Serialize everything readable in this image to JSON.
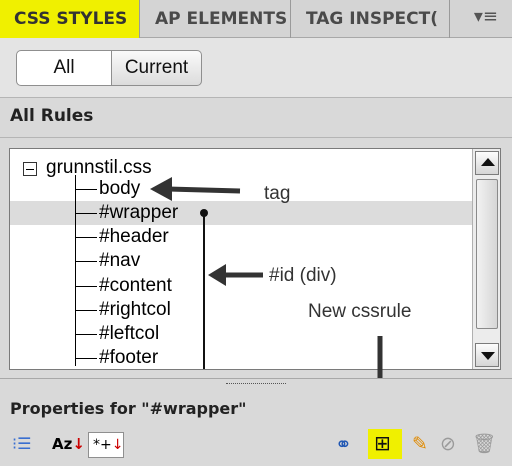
{
  "tabs": [
    {
      "label": "CSS STYLES",
      "active": true
    },
    {
      "label": "AP ELEMENTS",
      "active": false
    },
    {
      "label": "TAG INSPECT(",
      "active": false
    }
  ],
  "toggle": {
    "all": "All",
    "current": "Current"
  },
  "rules_header": "All Rules",
  "tree": {
    "root": "grunnstil.css",
    "items": [
      "body",
      "#wrapper",
      "#header",
      "#nav",
      "#content",
      "#rightcol",
      "#leftcol",
      "#footer"
    ],
    "selected": "#wrapper"
  },
  "annotations": {
    "tag": "tag",
    "id_div": "#id (div)",
    "new_rule": "New cssrule"
  },
  "properties": {
    "title": "Properties for \"#wrapper\"",
    "sort_az": "Az",
    "show_set": "*+"
  },
  "colors": {
    "highlight": "#f0f000",
    "panel": "#d9d9d9"
  },
  "icons": {
    "menu": "panel-menu-icon",
    "category_view": "category-view-icon",
    "sort_az": "sort-az-icon",
    "show_set": "show-set-properties-icon",
    "attach": "attach-stylesheet-icon",
    "new_rule": "new-css-rule-icon",
    "edit": "edit-rule-icon",
    "disable": "disable-property-icon",
    "delete": "delete-rule-icon"
  }
}
